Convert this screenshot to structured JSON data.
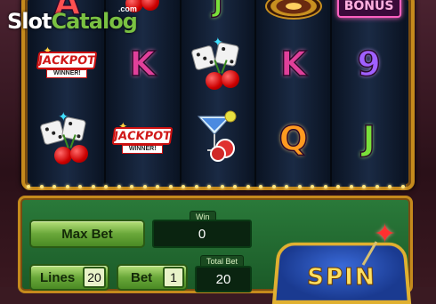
{
  "logo": {
    "slot": "Slot",
    "catalog": "Catalog",
    "com": ".com"
  },
  "reels": {
    "col1": {
      "top": "A",
      "mid": "jackpot",
      "bottom": "dice-cherries"
    },
    "col2": {
      "top": "cherries",
      "mid": "K",
      "bottom": "jackpot"
    },
    "col3": {
      "top": "J",
      "mid": "dice-cherries",
      "bottom": "cocktail"
    },
    "col4": {
      "top": "roulette",
      "mid": "K",
      "bottom": "Q"
    },
    "col5": {
      "top": "bonus",
      "mid": "9",
      "bottom": "J"
    }
  },
  "symbols": {
    "jackpot_text": "JACKPOT",
    "winner_text": "WINNER!",
    "bonus_text": "BONUS",
    "k": "K",
    "j": "J",
    "q": "Q",
    "nine": "9",
    "a": "A"
  },
  "controls": {
    "max_bet_label": "Max Bet",
    "win_label": "Win",
    "win_value": "0",
    "lines_label": "Lines",
    "lines_value": "20",
    "bet_label": "Bet",
    "bet_value": "1",
    "total_bet_label": "Total Bet",
    "total_bet_value": "20",
    "spin_label": "SPIN"
  },
  "colors": {
    "frame_gold": "#c58a1c",
    "panel_green": "#2a7a3a",
    "spin_blue": "#1a3a90"
  }
}
